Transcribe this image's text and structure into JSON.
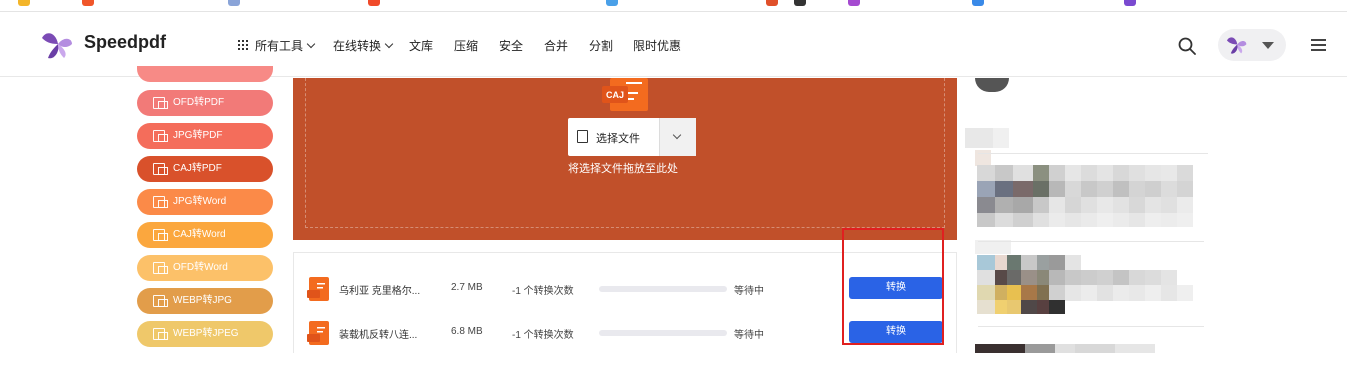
{
  "header": {
    "brand": "Speedpdf",
    "nav": [
      {
        "label": "所有工具",
        "dropdown": true
      },
      {
        "label": "在线转换",
        "dropdown": true
      },
      {
        "label": "文库",
        "dropdown": false
      },
      {
        "label": "压缩",
        "dropdown": false
      },
      {
        "label": "安全",
        "dropdown": false
      },
      {
        "label": "合并",
        "dropdown": false
      },
      {
        "label": "分割",
        "dropdown": false
      },
      {
        "label": "限时优惠",
        "dropdown": false
      }
    ],
    "icons": {
      "search": "search-icon",
      "menu": "hamburger-menu-icon",
      "user_caret": "caret-down-icon"
    }
  },
  "sidebar": {
    "items": [
      {
        "label": "",
        "color": "#f78a86"
      },
      {
        "label": "OFD转PDF",
        "color": "#f27a78"
      },
      {
        "label": "JPG转PDF",
        "color": "#f46d5b"
      },
      {
        "label": "CAJ转PDF",
        "color": "#d9512b"
      },
      {
        "label": "JPG转Word",
        "color": "#fb8a48"
      },
      {
        "label": "CAJ转Word",
        "color": "#fba73e"
      },
      {
        "label": "OFD转Word",
        "color": "#fcc169"
      },
      {
        "label": "WEBP转JPG",
        "color": "#e29d4a"
      },
      {
        "label": "WEBP转JPEG",
        "color": "#efc86a"
      }
    ]
  },
  "upload": {
    "background": "#c1502a",
    "doc_badge": "CAJ",
    "select_label": "选择文件",
    "drop_hint": "将选择文件拖放至此处"
  },
  "files": [
    {
      "name": "乌利亚 克里格尔...",
      "size": "2.7 MB",
      "count": "-1 个转换次数",
      "progress": 0,
      "status": "等待中",
      "action": "转换"
    },
    {
      "name": "装载机反转八连...",
      "size": "6.8 MB",
      "count": "-1 个转换次数",
      "progress": 0,
      "status": "等待中",
      "action": "转换"
    }
  ],
  "colors": {
    "accent": "#2a63e6",
    "highlight": "#e02020",
    "brand": "#7b4bb5"
  }
}
